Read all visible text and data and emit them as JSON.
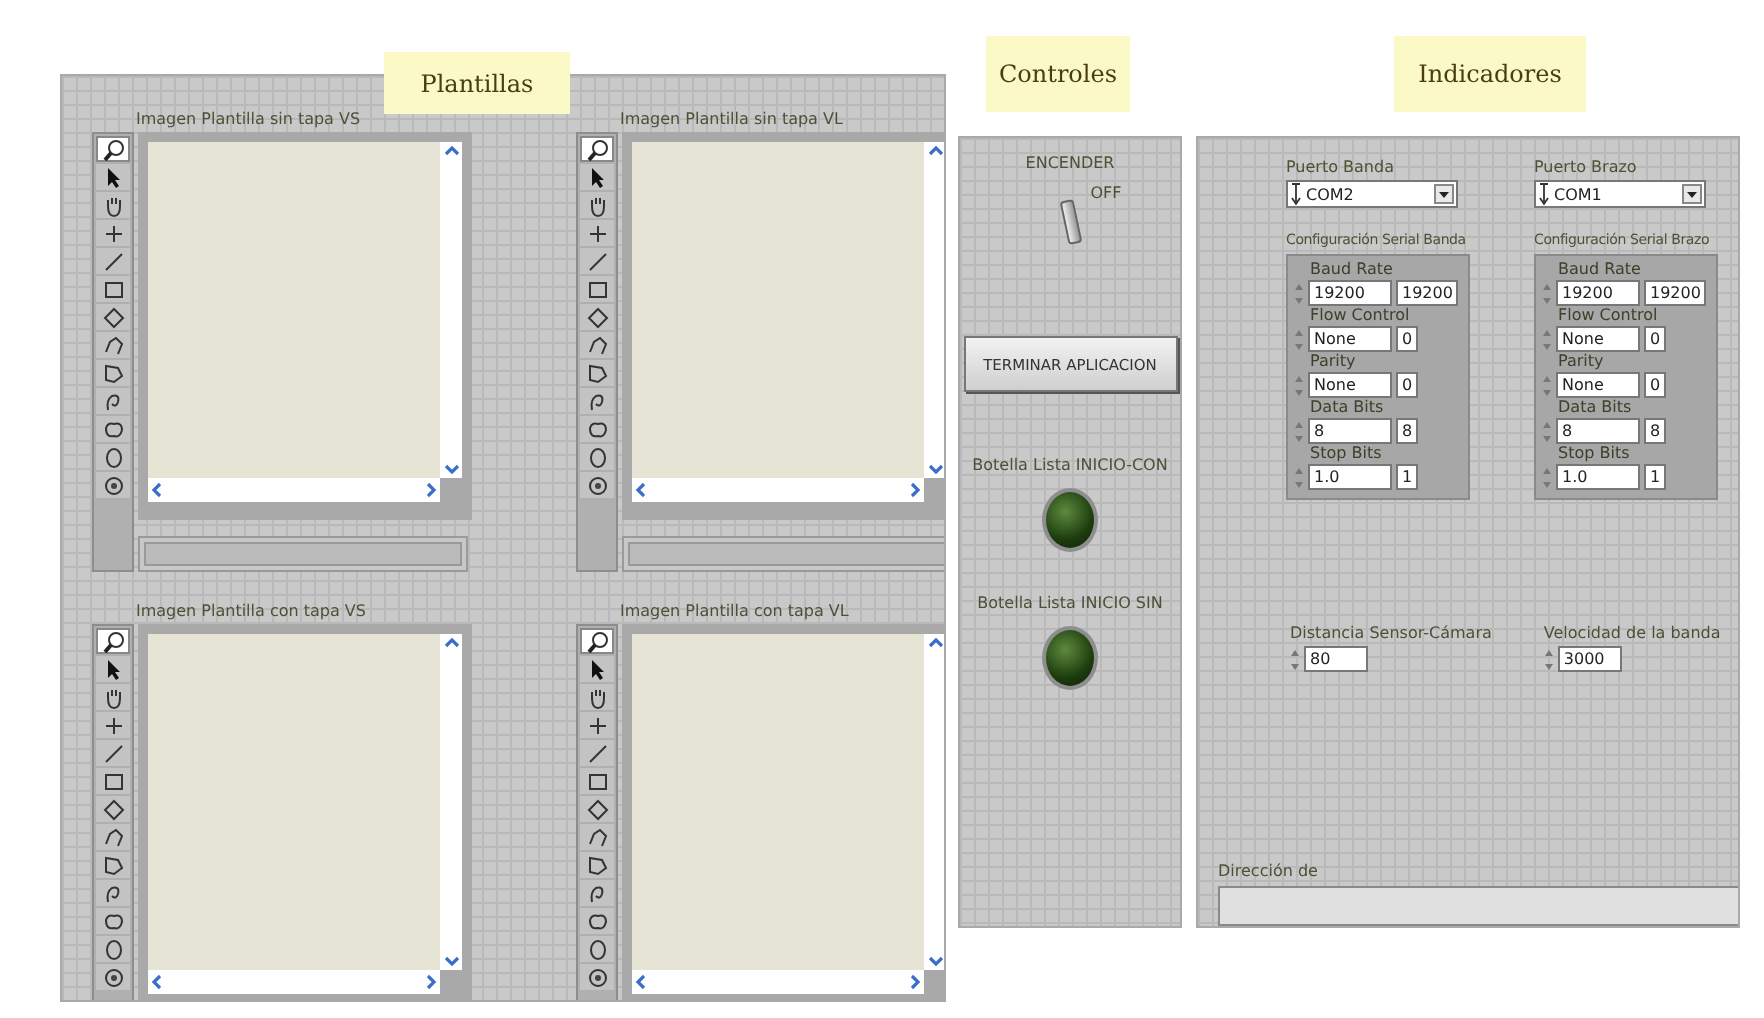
{
  "plantillas": {
    "title": "Plantillas",
    "images": [
      {
        "label": "Imagen Plantilla sin tapa VS",
        "status_field": true
      },
      {
        "label": "Imagen Plantilla sin tapa VL",
        "status_field": true
      },
      {
        "label": "Imagen Plantilla con tapa VS",
        "status_field": false
      },
      {
        "label": "Imagen Plantilla con tapa VL",
        "status_field": false
      }
    ],
    "tools": [
      {
        "kind": "zoom",
        "selected": true
      },
      {
        "kind": "pointer",
        "selected": false
      },
      {
        "kind": "pan",
        "selected": false
      },
      {
        "kind": "point",
        "selected": false
      },
      {
        "kind": "line",
        "selected": false
      },
      {
        "kind": "rectangle",
        "selected": false
      },
      {
        "kind": "rotated",
        "selected": false
      },
      {
        "kind": "polyline",
        "selected": false
      },
      {
        "kind": "polygon",
        "selected": false
      },
      {
        "kind": "freeline",
        "selected": false
      },
      {
        "kind": "freeregion",
        "selected": false
      },
      {
        "kind": "oval",
        "selected": false
      },
      {
        "kind": "annulus",
        "selected": false
      }
    ]
  },
  "controles": {
    "title": "Controles",
    "switch": {
      "label": "ENCENDER",
      "state_text": "OFF",
      "on": false
    },
    "button": "TERMINAR APLICACION",
    "leds": [
      {
        "label": "Botella Lista INICIO-CON",
        "on": false
      },
      {
        "label": "Botella Lista INICIO SIN",
        "on": false
      }
    ]
  },
  "indicadores": {
    "title": "Indicadores",
    "ports": [
      {
        "label": "Puerto Banda",
        "value": "COM2",
        "config": {
          "label": "Configuración Serial Banda",
          "fields": [
            {
              "label": "Baud Rate",
              "value": "19200",
              "code": "19200"
            },
            {
              "label": "Flow Control",
              "value": "None",
              "code": "0"
            },
            {
              "label": "Parity",
              "value": "None",
              "code": "0"
            },
            {
              "label": "Data Bits",
              "value": "8",
              "code": "8"
            },
            {
              "label": "Stop Bits",
              "value": "1.0",
              "code": "1"
            }
          ]
        }
      },
      {
        "label": "Puerto Brazo",
        "value": "COM1",
        "config": {
          "label": "Configuración Serial Brazo",
          "fields": [
            {
              "label": "Baud Rate",
              "value": "19200",
              "code": "19200"
            },
            {
              "label": "Flow Control",
              "value": "None",
              "code": "0"
            },
            {
              "label": "Parity",
              "value": "None",
              "code": "0"
            },
            {
              "label": "Data Bits",
              "value": "8",
              "code": "8"
            },
            {
              "label": "Stop Bits",
              "value": "1.0",
              "code": "1"
            }
          ]
        }
      }
    ],
    "numerics": [
      {
        "label": "Distancia Sensor-Cámara",
        "value": "80"
      },
      {
        "label": "Velocidad de la banda",
        "value": "3000"
      }
    ],
    "string": {
      "label": "Dirección de"
    }
  }
}
